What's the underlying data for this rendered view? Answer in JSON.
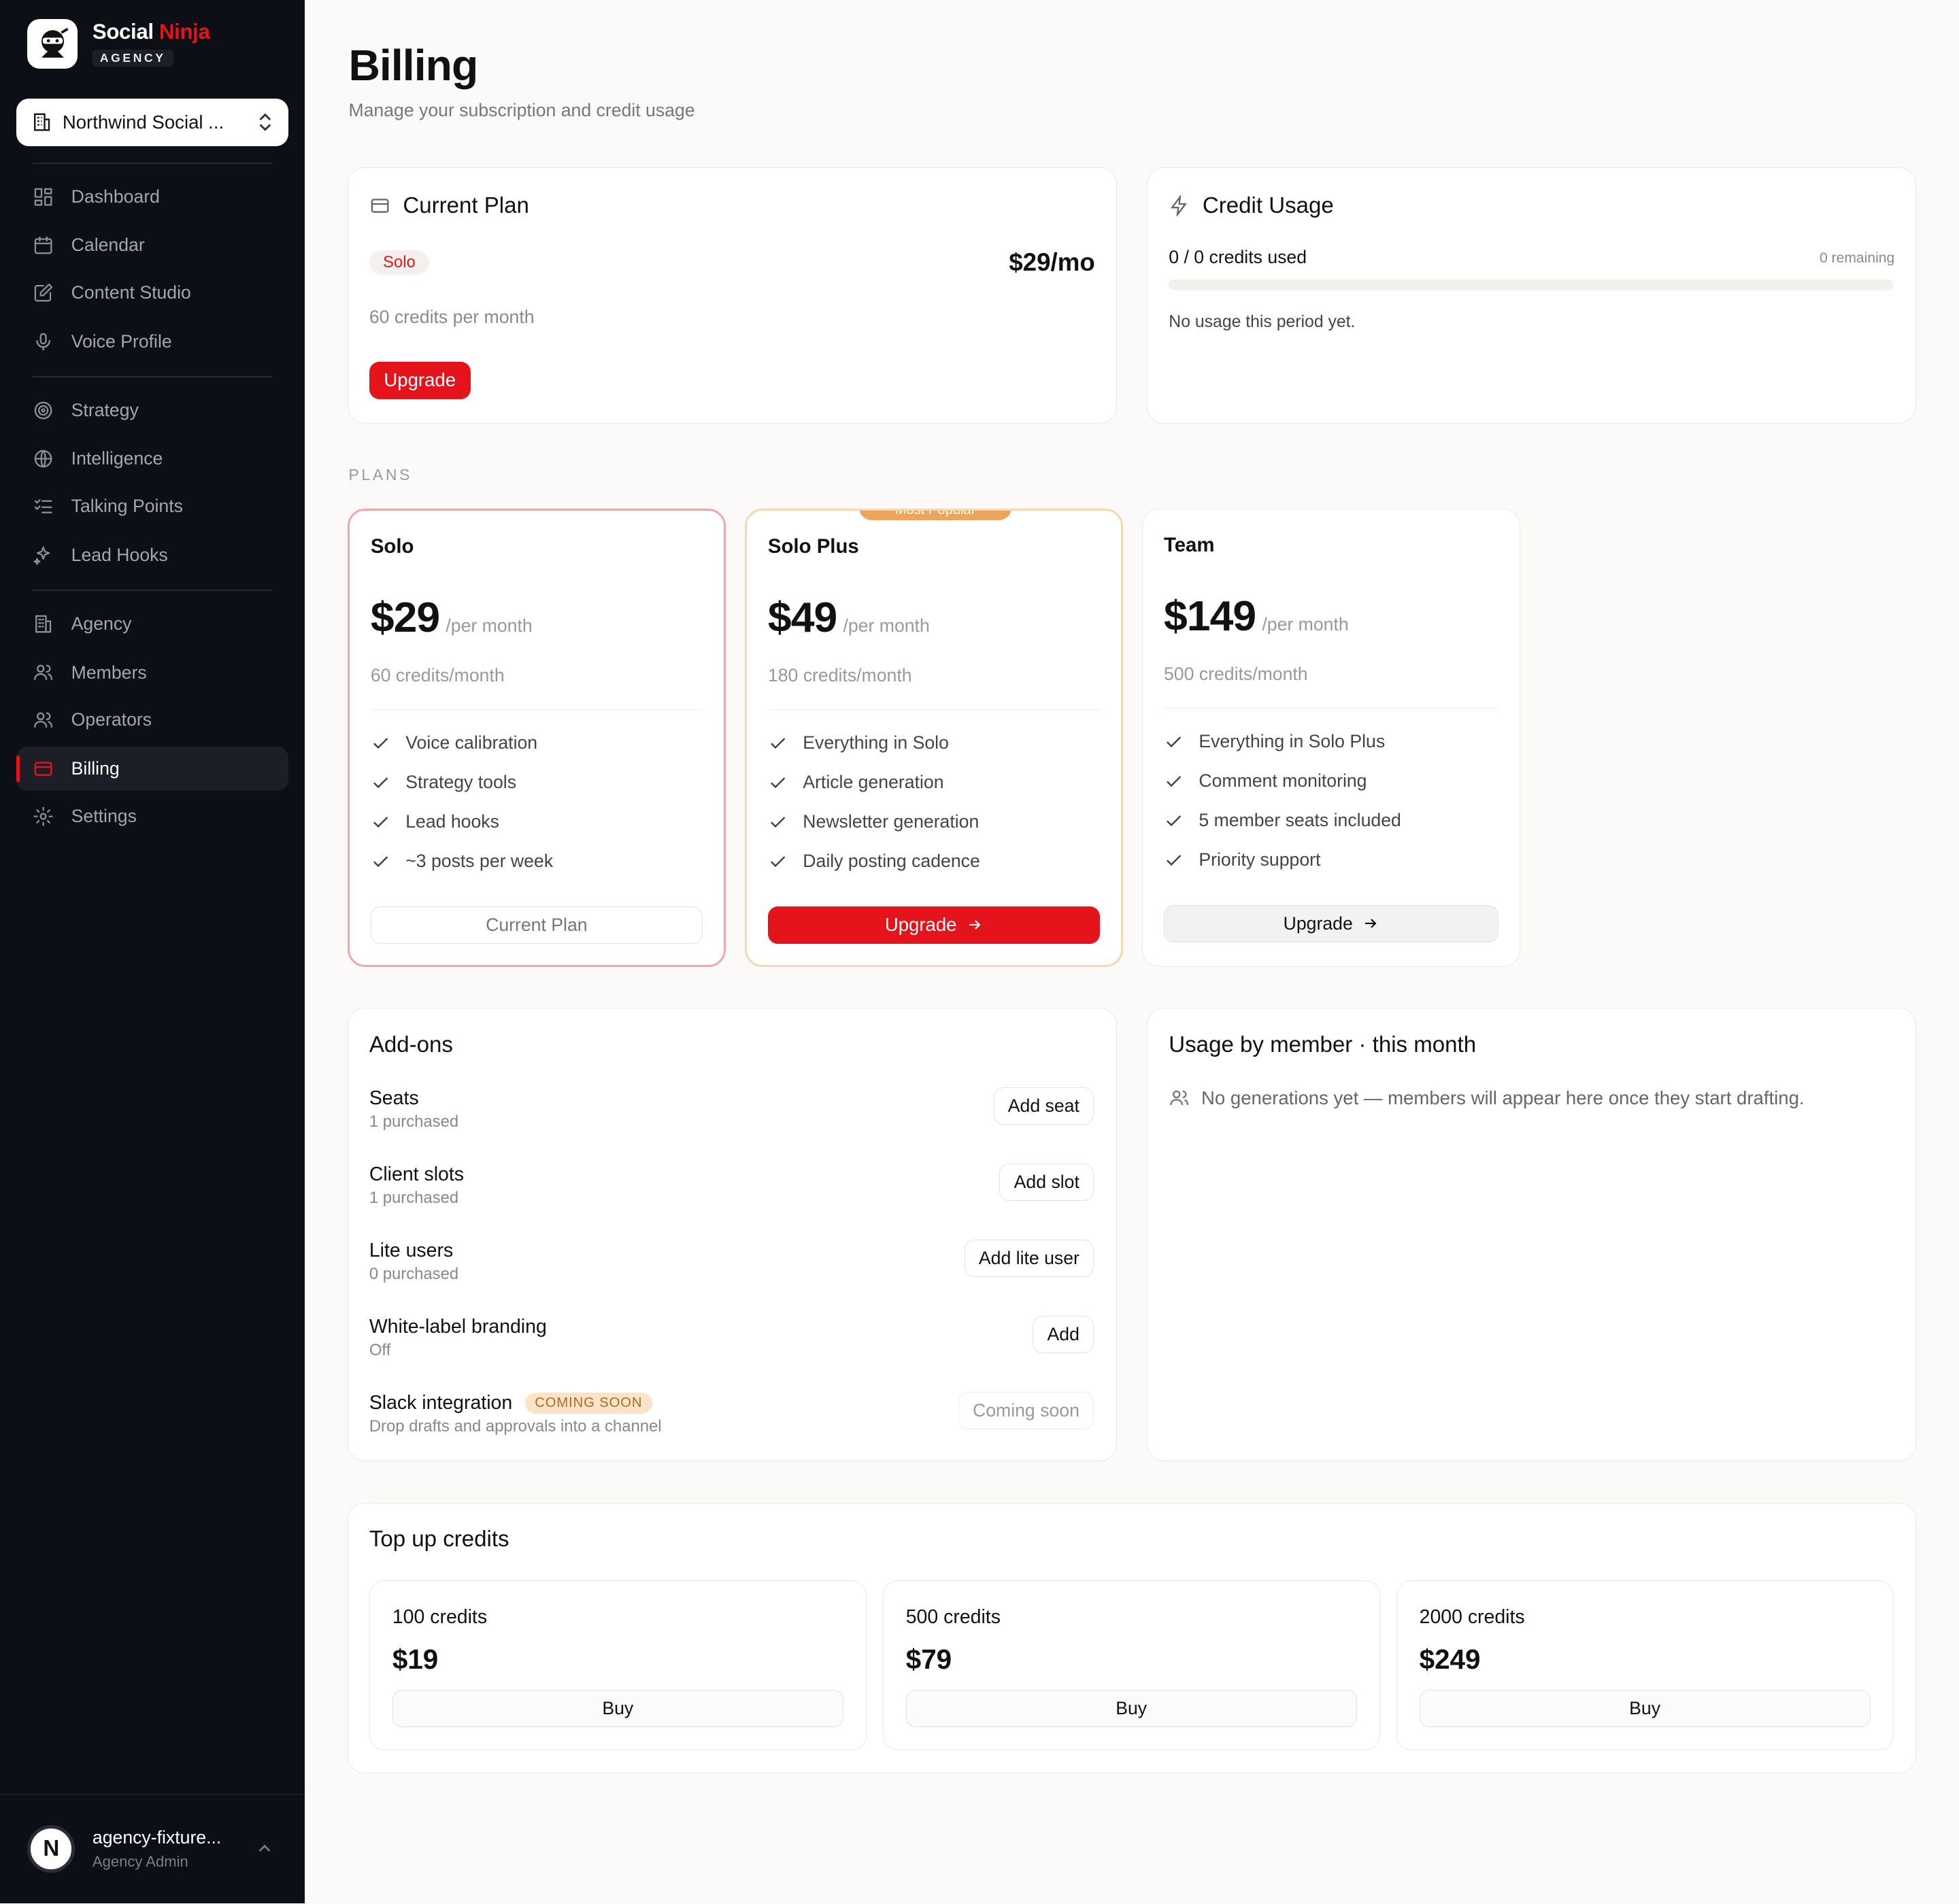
{
  "brand": {
    "name_main": "Social",
    "name_accent": "Ninja",
    "sub": "AGENCY",
    "accent_color": "#e5141c"
  },
  "workspace": {
    "label": "Northwind Social ..."
  },
  "nav": {
    "items": [
      {
        "label": "Dashboard",
        "icon": "grid-icon"
      },
      {
        "label": "Calendar",
        "icon": "calendar-icon"
      },
      {
        "label": "Content Studio",
        "icon": "edit-icon"
      },
      {
        "label": "Voice Profile",
        "icon": "mic-icon"
      },
      {
        "label": "Strategy",
        "icon": "target-icon"
      },
      {
        "label": "Intelligence",
        "icon": "globe-icon"
      },
      {
        "label": "Talking Points",
        "icon": "checklist-icon"
      },
      {
        "label": "Lead Hooks",
        "icon": "sparkles-icon"
      },
      {
        "label": "Agency",
        "icon": "building-icon"
      },
      {
        "label": "Members",
        "icon": "users-icon"
      },
      {
        "label": "Operators",
        "icon": "users-icon"
      },
      {
        "label": "Billing",
        "icon": "credit-card-icon",
        "active": true
      },
      {
        "label": "Settings",
        "icon": "gear-icon"
      }
    ]
  },
  "user": {
    "initial": "N",
    "name": "agency-fixture...",
    "role": "Agency Admin"
  },
  "page": {
    "title": "Billing",
    "subtitle": "Manage your subscription and credit usage"
  },
  "current_plan": {
    "title": "Current Plan",
    "badge": "Solo",
    "price": "$29/mo",
    "credits": "60 credits per month",
    "upgrade_label": "Upgrade"
  },
  "credit_usage": {
    "title": "Credit Usage",
    "used": "0 / 0 credits used",
    "remaining": "0 remaining",
    "progress_fraction": 0,
    "empty": "No usage this period yet."
  },
  "plans_label": "PLANS",
  "plans": [
    {
      "name": "Solo",
      "amount": "$29",
      "per": "/per month",
      "credits": "60 credits/month",
      "features": [
        "Voice calibration",
        "Strategy tools",
        "Lead hooks",
        "~3 posts per week"
      ],
      "button": "Current Plan"
    },
    {
      "name": "Solo Plus",
      "ribbon": "Most Popular",
      "amount": "$49",
      "per": "/per month",
      "credits": "180 credits/month",
      "features": [
        "Everything in Solo",
        "Article generation",
        "Newsletter generation",
        "Daily posting cadence"
      ],
      "button": "Upgrade"
    },
    {
      "name": "Team",
      "amount": "$149",
      "per": "/per month",
      "credits": "500 credits/month",
      "features": [
        "Everything in Solo Plus",
        "Comment monitoring",
        "5 member seats included",
        "Priority support"
      ],
      "button": "Upgrade"
    }
  ],
  "addons": {
    "title": "Add-ons",
    "items": [
      {
        "name": "Seats",
        "desc": "1 purchased",
        "button": "Add seat"
      },
      {
        "name": "Client slots",
        "desc": "1 purchased",
        "button": "Add slot"
      },
      {
        "name": "Lite users",
        "desc": "0 purchased",
        "button": "Add lite user"
      },
      {
        "name": "White-label branding",
        "desc": "Off",
        "button": "Add"
      },
      {
        "name": "Slack integration",
        "badge": "COMING SOON",
        "desc": "Drop drafts and approvals into a channel",
        "button": "Coming soon"
      }
    ]
  },
  "usage_by_member": {
    "title": "Usage by member · this month",
    "empty": "No generations yet — members will appear here once they start drafting."
  },
  "topup": {
    "title": "Top up credits",
    "items": [
      {
        "name": "100 credits",
        "price": "$19",
        "button": "Buy"
      },
      {
        "name": "500 credits",
        "price": "$79",
        "button": "Buy"
      },
      {
        "name": "2000 credits",
        "price": "$249",
        "button": "Buy"
      }
    ]
  }
}
